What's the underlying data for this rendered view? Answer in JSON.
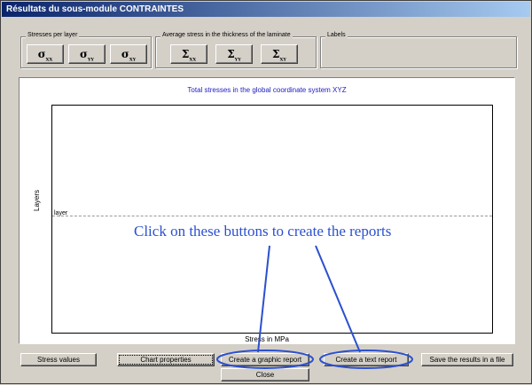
{
  "window": {
    "title": "Résultats du sous-module CONTRAINTES"
  },
  "stresses_group": {
    "label": "Stresses per layer",
    "buttons": [
      {
        "sym": "σ",
        "sub": "XX"
      },
      {
        "sym": "σ",
        "sub": "YY"
      },
      {
        "sym": "σ",
        "sub": "XY"
      }
    ]
  },
  "average_group": {
    "label": "Average stress in the thickness of the laminate",
    "buttons": [
      {
        "sym": "Σ",
        "sub": "XX"
      },
      {
        "sym": "Σ",
        "sub": "YY"
      },
      {
        "sym": "Σ",
        "sub": "XY"
      }
    ]
  },
  "labels_group": {
    "label": "Labels"
  },
  "chart": {
    "title": "Total stresses in the global coordinate system XYZ",
    "ylabel": "Layers",
    "xlabel": "Stress in MPa",
    "layer_tick": "layer"
  },
  "annotation": "Click on these buttons to create the reports",
  "footer": {
    "stress_values": "Stress values",
    "chart_properties": "Chart properties",
    "graphic_report": "Create a graphic report",
    "text_report": "Create a text report",
    "save_results": "Save the results in a file",
    "close": "Close"
  },
  "colors": {
    "annotation": "#2b50d0",
    "chart_title": "#2020c0",
    "title_bar": "#0a246a"
  }
}
